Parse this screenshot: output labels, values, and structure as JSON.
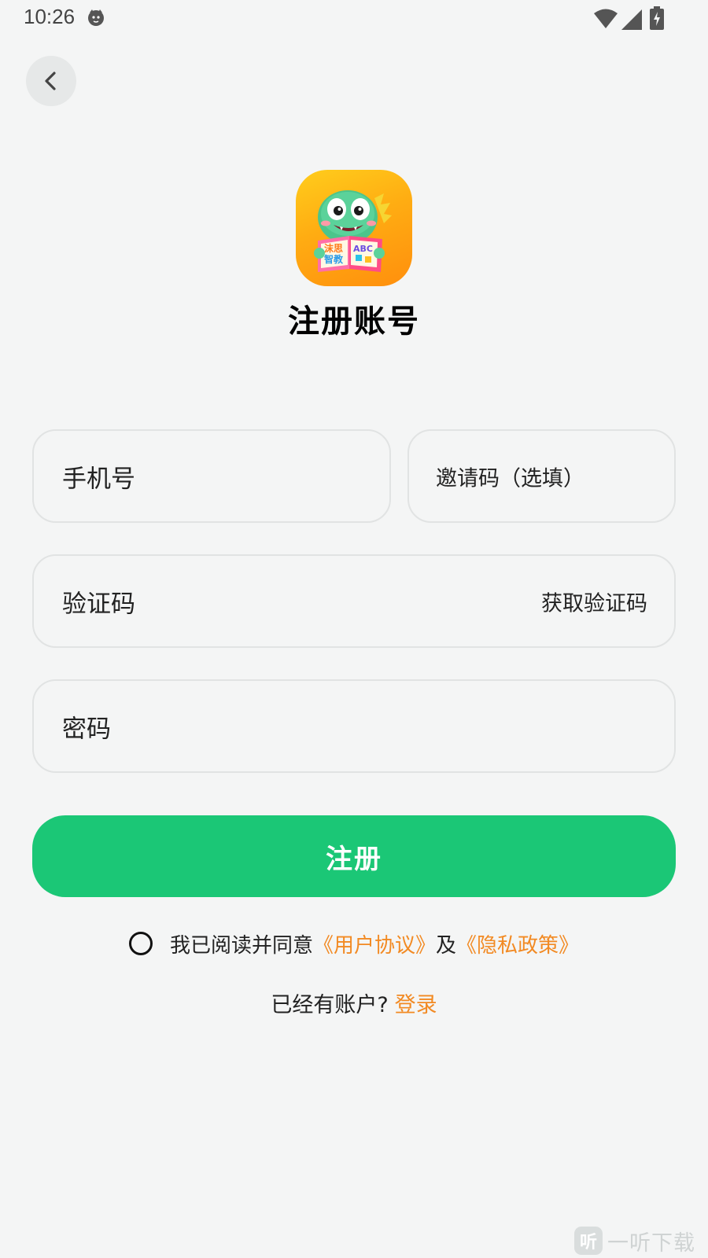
{
  "status_bar": {
    "time": "10:26",
    "icons": [
      "face-icon",
      "wifi-icon",
      "signal-icon",
      "battery-icon"
    ]
  },
  "nav": {
    "back_icon": "chevron-left-icon"
  },
  "header": {
    "logo_text_top": "沫思",
    "logo_text_bottom": "智教",
    "logo_letters": "ABC",
    "title": "注册账号"
  },
  "form": {
    "phone_placeholder": "手机号",
    "invite_placeholder": "邀请码（选填）",
    "code_placeholder": "验证码",
    "get_code_label": "获取验证码",
    "password_placeholder": "密码",
    "submit_label": "注册"
  },
  "agreement": {
    "text": "我已阅读并同意",
    "user_agreement": "《用户协议》",
    "and": "及",
    "privacy_policy": "《隐私政策》"
  },
  "login_prompt": {
    "question": "已经有账户?",
    "link": "登录"
  },
  "watermark": {
    "icon_char": "听",
    "text": "一听下载"
  },
  "colors": {
    "background": "#f4f5f5",
    "primary_green": "#1bc776",
    "link_orange": "#f28a23",
    "logo_orange": "#ffac12"
  }
}
